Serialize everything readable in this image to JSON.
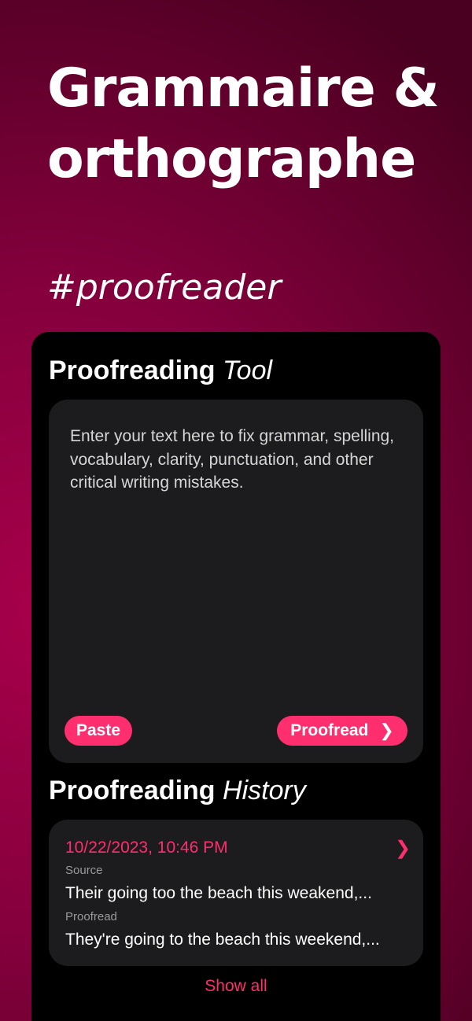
{
  "promo": {
    "headline_line1": "Grammaire &",
    "headline_line2": "orthographe",
    "hashtag": "#proofreader"
  },
  "tool": {
    "title_strong": "Proofreading",
    "title_light": "Tool",
    "placeholder": "Enter your text here to fix grammar, spelling, vocabulary, clarity, punctuation, and other critical writing mistakes.",
    "paste_label": "Paste",
    "proofread_label": "Proofread",
    "proofread_icon": "chevron-right-icon"
  },
  "history": {
    "title_strong": "Proofreading",
    "title_light": "History",
    "items": [
      {
        "date": "10/22/2023, 10:46 PM",
        "source_label": "Source",
        "source_text": "Their going too the beach this weakend,...",
        "proofread_label": "Proofread",
        "proofread_text": "They're going to the beach this weekend,..."
      }
    ],
    "show_all_label": "Show all"
  },
  "colors": {
    "accent": "#ff2e6e",
    "card": "#1c1c1e",
    "background_start": "#a8004a",
    "background_end": "#4a0020"
  }
}
